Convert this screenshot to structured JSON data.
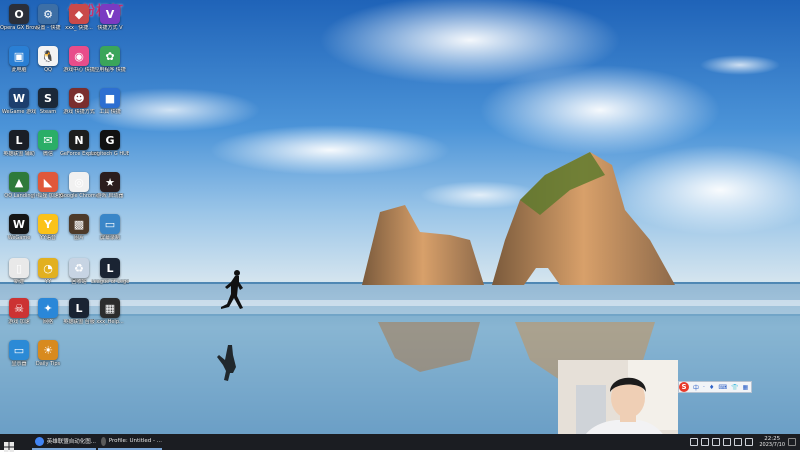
{
  "watermark": "仙粉杆打",
  "desktop_icons": [
    {
      "name": "opera-gx-icon",
      "label": "Opera GX Browser",
      "color": "#2b2f3a",
      "glyph": "O"
    },
    {
      "name": "settings-icon",
      "label": "设置 - 快捷",
      "color": "#3d6fa6",
      "glyph": "⚙"
    },
    {
      "name": "app-shortcut-icon",
      "label": "xxx_ 快捷...",
      "color": "#c94a4a",
      "glyph": "◆"
    },
    {
      "name": "v-app-icon",
      "label": "快捷方式 V",
      "color": "#7a3bc2",
      "glyph": "V"
    },
    {
      "name": "computer-icon",
      "label": "此电脑",
      "color": "#2a7fd4",
      "glyph": "▣"
    },
    {
      "name": "qq-icon",
      "label": "QQ",
      "color": "#f3f3f3",
      "glyph": "🐧"
    },
    {
      "name": "game-launcher-icon",
      "label": "游戏中心 快捷",
      "color": "#e84d8a",
      "glyph": "◉"
    },
    {
      "name": "green-app-icon",
      "label": "应用程序 快捷",
      "color": "#3aa55a",
      "glyph": "✿"
    },
    {
      "name": "wegame-icon",
      "label": "WeGame 游戏",
      "color": "#1d3f6e",
      "glyph": "W"
    },
    {
      "name": "steam-icon",
      "label": "Steam",
      "color": "#1b2838",
      "glyph": "S"
    },
    {
      "name": "game-icon",
      "label": "游戏 快捷方式",
      "color": "#7a2e2e",
      "glyph": "☻"
    },
    {
      "name": "blue-app-icon",
      "label": "工具 快捷",
      "color": "#2d6fd1",
      "glyph": "■"
    },
    {
      "name": "league-client-icon",
      "label": "英雄联盟 辅助",
      "color": "#1a1e26",
      "glyph": "L"
    },
    {
      "name": "wechat-icon",
      "label": "微信",
      "color": "#2aae67",
      "glyph": "✉"
    },
    {
      "name": "nvidia-icon",
      "label": "GeForce Experience",
      "color": "#1d1d1d",
      "glyph": "N"
    },
    {
      "name": "logitech-icon",
      "label": "Logitech G HUB",
      "color": "#111111",
      "glyph": "G"
    },
    {
      "name": "picture-app-icon",
      "label": "QQ Landing",
      "color": "#2e7a3a",
      "glyph": "▲"
    },
    {
      "name": "fox-app-icon",
      "label": "小狐狸 加速器",
      "color": "#e0583a",
      "glyph": "◣"
    },
    {
      "name": "chrome-icon",
      "label": "Google Chrome",
      "color": "#f1f1f1",
      "glyph": "◎"
    },
    {
      "name": "red-game-icon",
      "label": "游戏 启动器",
      "color": "#2b1d1d",
      "glyph": "★"
    },
    {
      "name": "wegame-dark-icon",
      "label": "WeGame",
      "color": "#151515",
      "glyph": "W"
    },
    {
      "name": "yy-icon",
      "label": "YY语音",
      "color": "#fbc21a",
      "glyph": "Y"
    },
    {
      "name": "photo-icon",
      "label": "图片",
      "color": "#4d3a2a",
      "glyph": "▩"
    },
    {
      "name": "screenshot-icon",
      "label": "屏幕录制",
      "color": "#3a86c8",
      "glyph": "▭"
    },
    {
      "name": "document-icon",
      "label": "新建",
      "color": "#e9e9e9",
      "glyph": "▯"
    },
    {
      "name": "owl-app-icon",
      "label": "YY",
      "color": "#e2b020",
      "glyph": "◔"
    },
    {
      "name": "recycle-icon",
      "label": "回收站",
      "color": "#c7d4e3",
      "glyph": "♻"
    },
    {
      "name": "league-icon",
      "label": "League of Legends",
      "color": "#1a2433",
      "glyph": "L"
    },
    {
      "name": "pirate-game-icon",
      "label": "游戏 加速",
      "color": "#c33",
      "glyph": "☠"
    },
    {
      "name": "net-icon",
      "label": "网络",
      "color": "#2a87d8",
      "glyph": "✦"
    },
    {
      "name": "league-tw-icon",
      "label": "英雄联盟 台服",
      "color": "#1a2433",
      "glyph": "L"
    },
    {
      "name": "game-box-icon",
      "label": "xxx_Help...",
      "color": "#2c2c2c",
      "glyph": "▦"
    },
    {
      "name": "monitor-icon",
      "label": "显示器",
      "color": "#2b8ad6",
      "glyph": "▭"
    },
    {
      "name": "daily-app-icon",
      "label": "Daily Tips",
      "color": "#d88a1f",
      "glyph": "☀"
    }
  ],
  "taskbar": {
    "apps": [
      {
        "label": "英雄联盟自动化图...",
        "color": "#4285f4"
      },
      {
        "label": "Profile: Untitled - ...",
        "color": "#5a5a5a"
      }
    ],
    "clock": {
      "time": "22:25",
      "date": "2023/7/10"
    }
  },
  "ime": {
    "logo": "S",
    "items": [
      "中",
      "·",
      "♦",
      "⌨",
      "👕",
      "▦"
    ]
  }
}
